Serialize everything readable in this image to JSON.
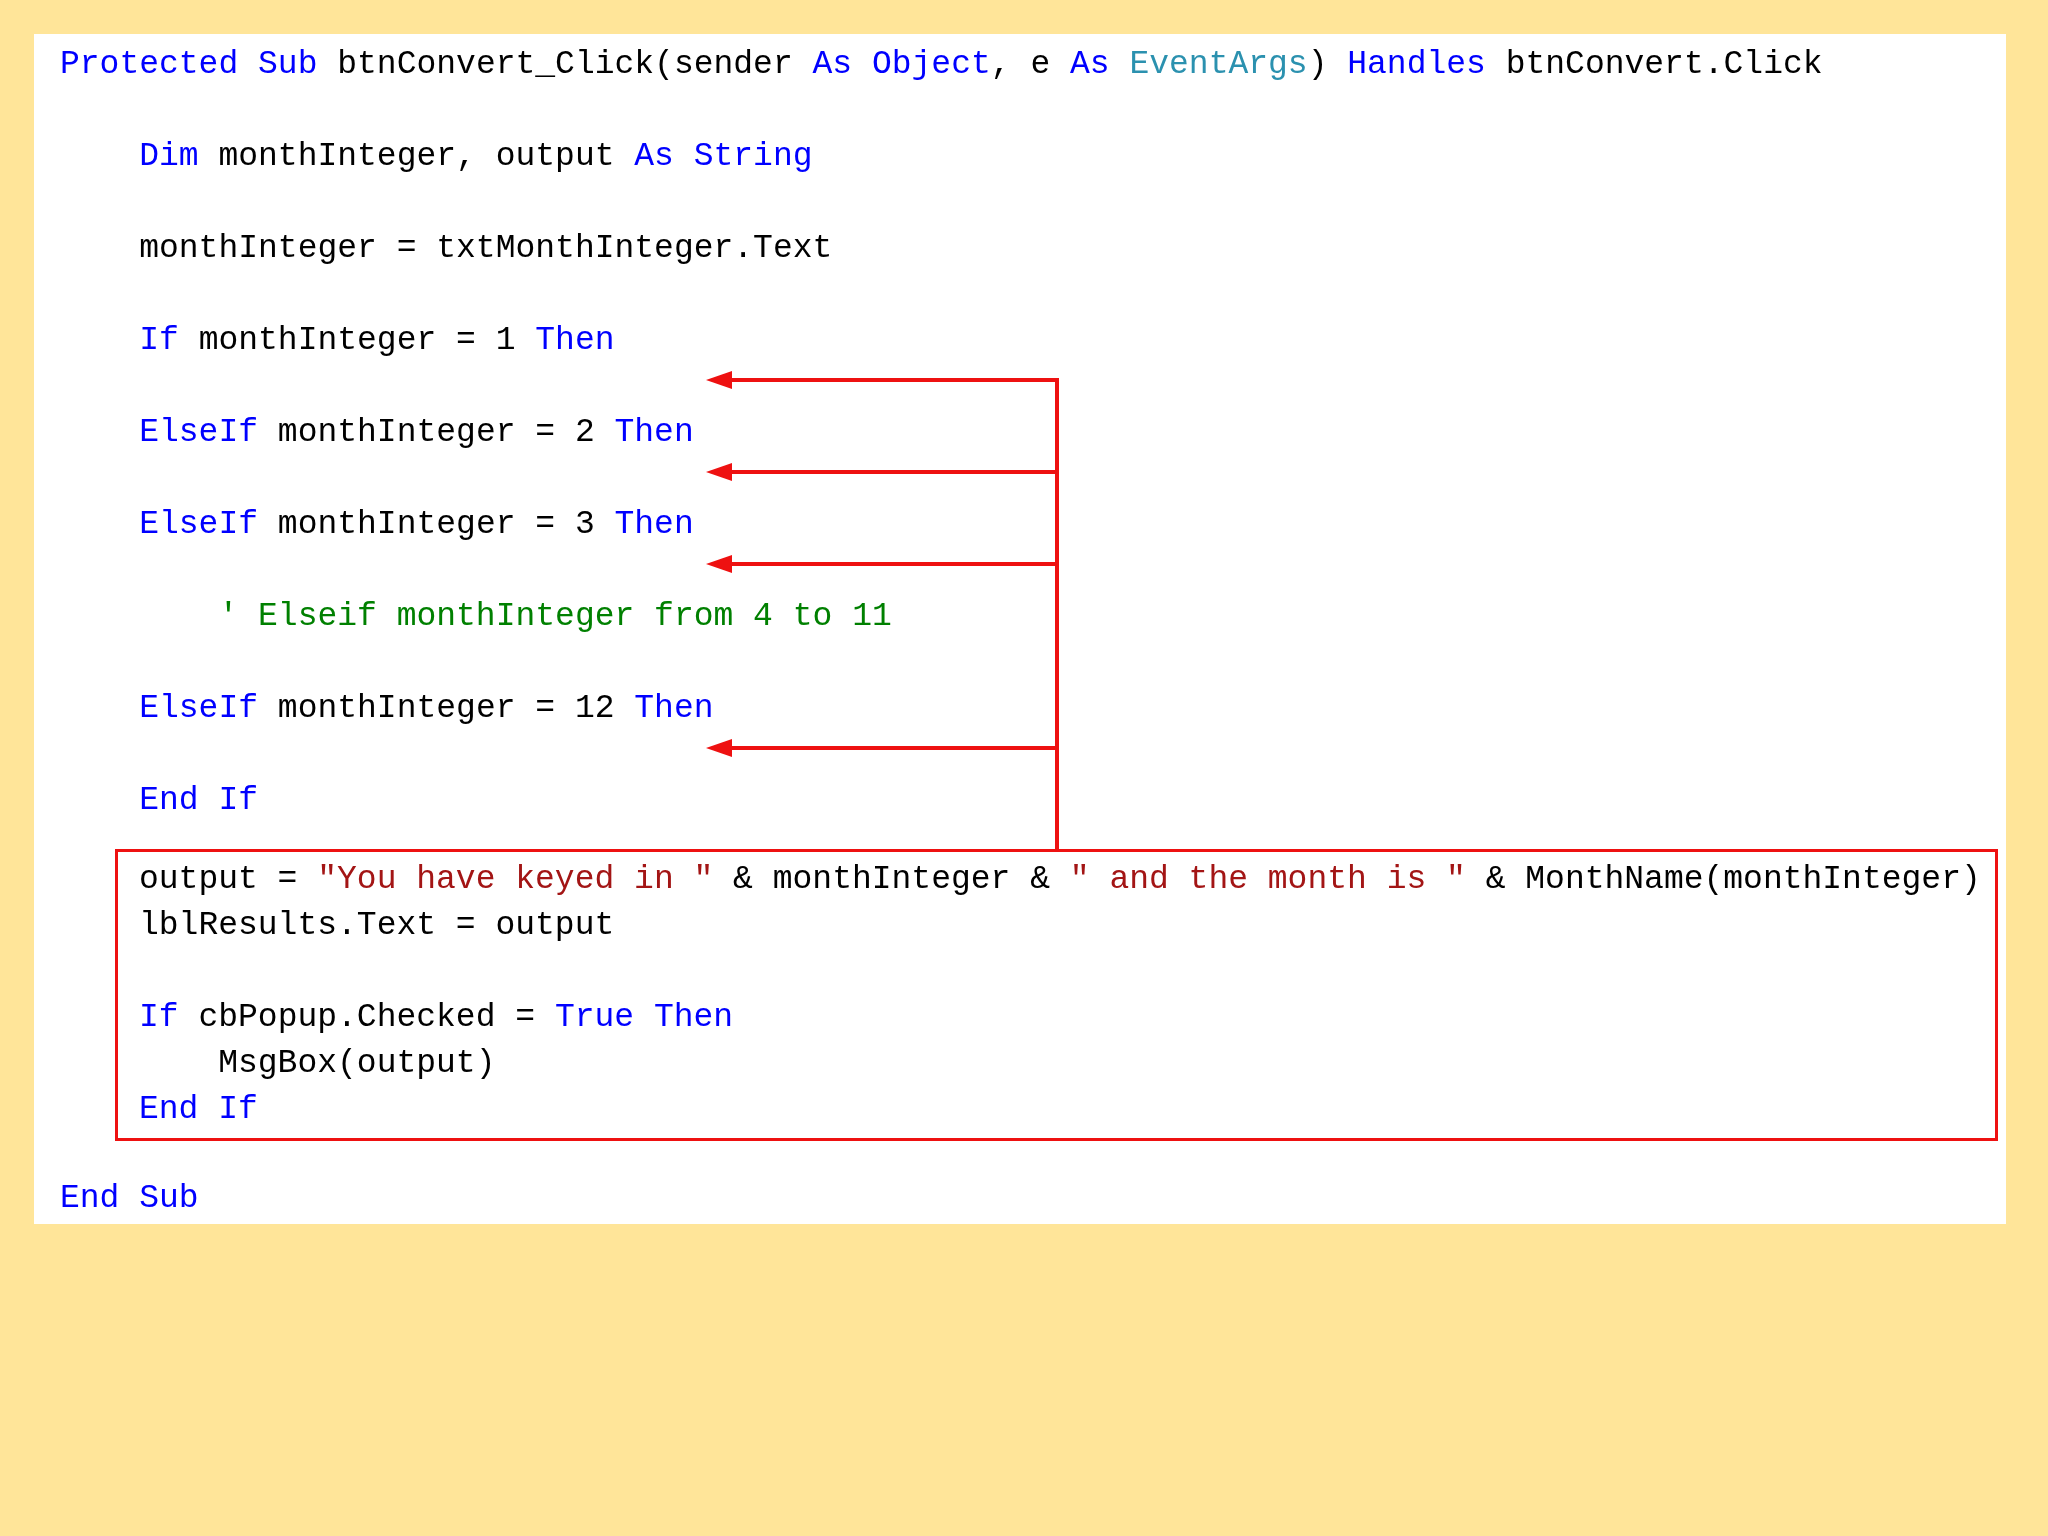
{
  "sections": [
    {
      "highlighted": false,
      "groups": [
        [
          {
            "tokens": [
              {
                "kind": "keyword",
                "text": "Protected Sub"
              },
              {
                "kind": "plain",
                "text": " btnConvert_Click(sender "
              },
              {
                "kind": "keyword",
                "text": "As Object"
              },
              {
                "kind": "plain",
                "text": ", e "
              },
              {
                "kind": "keyword",
                "text": "As "
              },
              {
                "kind": "type",
                "text": "EventArgs"
              },
              {
                "kind": "plain",
                "text": ") "
              },
              {
                "kind": "keyword",
                "text": "Handles"
              },
              {
                "kind": "plain",
                "text": " btnConvert.Click"
              }
            ]
          }
        ],
        [
          {
            "tokens": [
              {
                "kind": "keyword",
                "text": "    Dim"
              },
              {
                "kind": "plain",
                "text": " monthInteger, output "
              },
              {
                "kind": "keyword",
                "text": "As String"
              }
            ]
          }
        ],
        [
          {
            "tokens": [
              {
                "kind": "plain",
                "text": "    monthInteger = txtMonthInteger.Text"
              }
            ]
          }
        ],
        [
          {
            "arrow": true,
            "tokens": [
              {
                "kind": "keyword",
                "text": "    If"
              },
              {
                "kind": "plain",
                "text": " monthInteger = 1 "
              },
              {
                "kind": "keyword",
                "text": "Then"
              }
            ]
          }
        ],
        [
          {
            "arrow": true,
            "tokens": [
              {
                "kind": "keyword",
                "text": "    ElseIf"
              },
              {
                "kind": "plain",
                "text": " monthInteger = 2 "
              },
              {
                "kind": "keyword",
                "text": "Then"
              }
            ]
          }
        ],
        [
          {
            "arrow": true,
            "tokens": [
              {
                "kind": "keyword",
                "text": "    ElseIf"
              },
              {
                "kind": "plain",
                "text": " monthInteger = 3 "
              },
              {
                "kind": "keyword",
                "text": "Then"
              }
            ]
          }
        ],
        [
          {
            "tokens": [
              {
                "kind": "comment",
                "text": "        ' Elseif monthInteger from 4 to 11"
              }
            ]
          }
        ],
        [
          {
            "arrow": true,
            "tokens": [
              {
                "kind": "keyword",
                "text": "    ElseIf"
              },
              {
                "kind": "plain",
                "text": " monthInteger = 12 "
              },
              {
                "kind": "keyword",
                "text": "Then"
              }
            ]
          }
        ],
        [
          {
            "tokens": [
              {
                "kind": "keyword",
                "text": "    End If"
              }
            ]
          }
        ]
      ]
    },
    {
      "highlighted": true,
      "groups": [
        [
          {
            "tokens": [
              {
                "kind": "plain",
                "text": "output = "
              },
              {
                "kind": "string",
                "text": "\"You have keyed in \""
              },
              {
                "kind": "plain",
                "text": " & monthInteger & "
              },
              {
                "kind": "string",
                "text": "\" and the month is \""
              },
              {
                "kind": "plain",
                "text": " & MonthName(monthInteger)"
              }
            ]
          },
          {
            "tokens": [
              {
                "kind": "plain",
                "text": "lblResults.Text = output"
              }
            ]
          }
        ],
        [
          {
            "tokens": [
              {
                "kind": "keyword",
                "text": "If"
              },
              {
                "kind": "plain",
                "text": " cbPopup.Checked = "
              },
              {
                "kind": "keyword",
                "text": "True Then"
              }
            ]
          },
          {
            "tokens": [
              {
                "kind": "plain",
                "text": "    MsgBox(output)"
              }
            ]
          },
          {
            "tokens": [
              {
                "kind": "keyword",
                "text": "End If"
              }
            ]
          }
        ]
      ]
    },
    {
      "highlighted": false,
      "groups": [
        [
          {
            "tokens": [
              {
                "kind": "keyword",
                "text": "End Sub"
              }
            ]
          }
        ]
      ]
    }
  ]
}
